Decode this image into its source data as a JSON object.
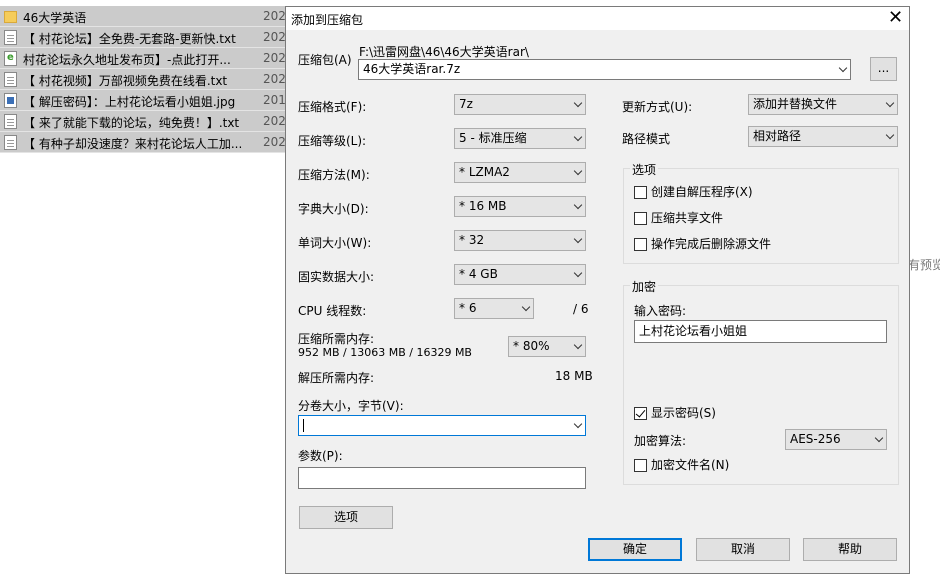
{
  "explorer": {
    "files": [
      {
        "icon": "folder-icon",
        "name": "46大学英语",
        "date": "202"
      },
      {
        "icon": "txt-file-icon",
        "name": "【 村花论坛】全免费-无套路-更新快.txt",
        "date": "202"
      },
      {
        "icon": "web-shortcut-icon",
        "name": "村花论坛永久地址发布页】-点此打开...",
        "date": "202"
      },
      {
        "icon": "txt-file-icon",
        "name": "【 村花视频】万部视频免费在线看.txt",
        "date": "202"
      },
      {
        "icon": "image-file-icon",
        "name": "【 解压密码】：上村花论坛看小姐姐.jpg",
        "date": "201"
      },
      {
        "icon": "txt-file-icon",
        "name": "【 来了就能下载的论坛，纯免费！】.txt",
        "date": "202"
      },
      {
        "icon": "txt-file-icon",
        "name": "【 有种子却没速度？来村花论坛人工加...",
        "date": "202"
      }
    ],
    "right_hint": "有预览"
  },
  "dialog": {
    "title": "添加到压缩包",
    "archive": {
      "label": "压缩包(A)",
      "path": "F:\\迅雷网盘\\46\\46大学英语rar\\",
      "value": "46大学英语rar.7z",
      "browse": "..."
    },
    "format": {
      "label": "压缩格式(F):",
      "value": "7z"
    },
    "level": {
      "label": "压缩等级(L):",
      "value": "5 - 标准压缩"
    },
    "method": {
      "label": "压缩方法(M):",
      "value": "* LZMA2"
    },
    "dict": {
      "label": "字典大小(D):",
      "value": "* 16 MB"
    },
    "word": {
      "label": "单词大小(W):",
      "value": "* 32"
    },
    "solid": {
      "label": "固实数据大小:",
      "value": "* 4 GB"
    },
    "cpu": {
      "label": "CPU 线程数:",
      "value": "* 6",
      "total": "/ 6"
    },
    "mem_compress": {
      "label": "压缩所需内存:",
      "detail": "952 MB / 13063 MB / 16329 MB",
      "value": "* 80%"
    },
    "mem_decompress": {
      "label": "解压所需内存:",
      "value": "18 MB"
    },
    "split": {
      "label": "分卷大小，字节(V):",
      "value": ""
    },
    "params": {
      "label": "参数(P):",
      "value": ""
    },
    "options_button": "选项",
    "update_mode": {
      "label": "更新方式(U):",
      "value": "添加并替换文件"
    },
    "path_mode": {
      "label": "路径模式",
      "value": "相对路径"
    },
    "options_group": {
      "title": "选项",
      "sfx": {
        "label": "创建自解压程序(X)",
        "checked": false
      },
      "shared": {
        "label": "压缩共享文件",
        "checked": false
      },
      "delete": {
        "label": "操作完成后删除源文件",
        "checked": false
      }
    },
    "encryption": {
      "title": "加密",
      "password_label": "输入密码:",
      "password": "上村花论坛看小姐姐",
      "show_password": {
        "label": "显示密码(S)",
        "checked": true
      },
      "method_label": "加密算法:",
      "method": "AES-256",
      "encrypt_names": {
        "label": "加密文件名(N)",
        "checked": false
      }
    },
    "buttons": {
      "ok": "确定",
      "cancel": "取消",
      "help": "帮助"
    }
  }
}
